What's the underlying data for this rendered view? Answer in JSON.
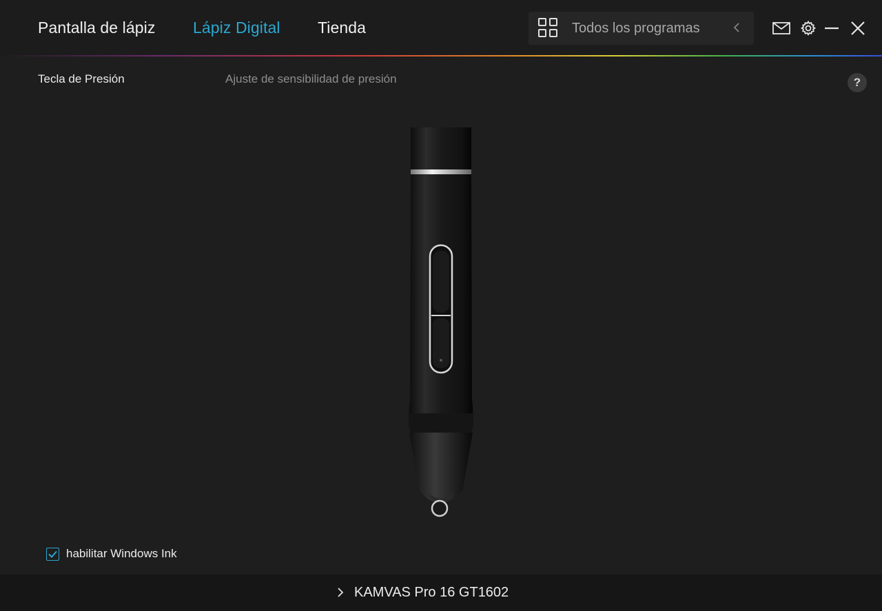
{
  "nav": {
    "tabs": [
      {
        "label": "Pantalla de lápiz",
        "active": false
      },
      {
        "label": "Lápiz Digital",
        "active": true
      },
      {
        "label": "Tienda",
        "active": false
      }
    ],
    "programs_label": "Todos los programas",
    "icons": [
      "grid-icon",
      "chevron-left-icon",
      "mail-icon",
      "gear-icon",
      "minimize-icon",
      "close-icon"
    ]
  },
  "section": {
    "title": "Tecla de Presión",
    "subtitle": "Ajuste de sensibilidad de presión",
    "help_label": "?"
  },
  "pen": {
    "icon": "stylus-pen-image"
  },
  "windows_ink": {
    "label": "habilitar Windows Ink",
    "checked": true
  },
  "footer": {
    "device_name": "KAMVAS Pro 16 GT1602"
  },
  "colors": {
    "accent": "#2ba8cf",
    "background": "#1e1e1e",
    "footer": "#161616"
  }
}
